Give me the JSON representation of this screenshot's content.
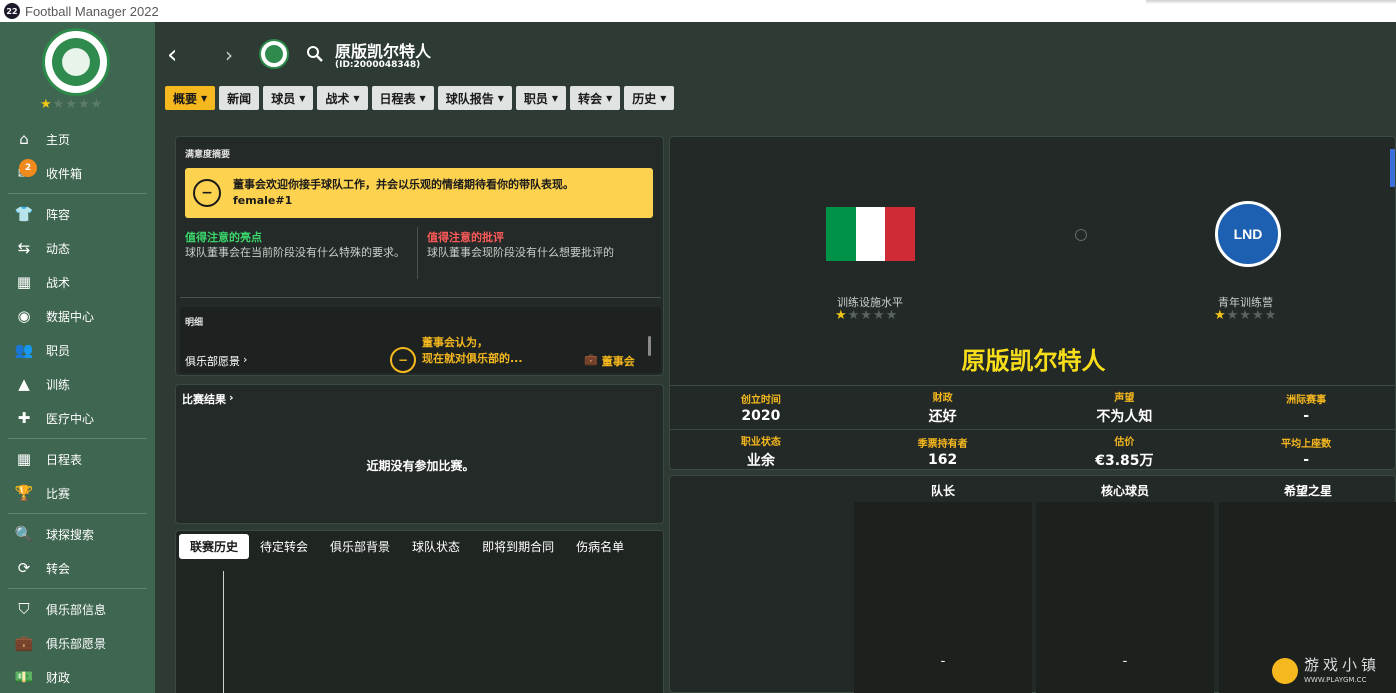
{
  "window": {
    "app_badge": "22",
    "title": "Football Manager 2022"
  },
  "sidebar": {
    "stars": "★★★★★",
    "inbox_badge": "2",
    "items": [
      {
        "icon": "home-icon",
        "glyph": "⌂",
        "label": "主页"
      },
      {
        "icon": "inbox-icon",
        "glyph": "✉",
        "label": "收件箱"
      },
      {
        "icon": "shirt-icon",
        "glyph": "👕",
        "label": "阵容"
      },
      {
        "icon": "dynamics-icon",
        "glyph": "⇆",
        "label": "动态"
      },
      {
        "icon": "tactics-icon",
        "glyph": "▦",
        "label": "战术"
      },
      {
        "icon": "data-hub-icon",
        "glyph": "◉",
        "label": "数据中心"
      },
      {
        "icon": "staff-icon",
        "glyph": "👥",
        "label": "职员"
      },
      {
        "icon": "training-icon",
        "glyph": "▲",
        "label": "训练"
      },
      {
        "icon": "medical-icon",
        "glyph": "✚",
        "label": "医疗中心"
      },
      {
        "icon": "calendar-icon",
        "glyph": "▦",
        "label": "日程表"
      },
      {
        "icon": "trophy-icon",
        "glyph": "🏆",
        "label": "比赛"
      },
      {
        "icon": "scouting-icon",
        "glyph": "🔍",
        "label": "球探搜索"
      },
      {
        "icon": "transfers-icon",
        "glyph": "⟳",
        "label": "转会"
      },
      {
        "icon": "club-info-icon",
        "glyph": "⛉",
        "label": "俱乐部信息"
      },
      {
        "icon": "club-vision-icon",
        "glyph": "💼",
        "label": "俱乐部愿景"
      },
      {
        "icon": "finances-icon",
        "glyph": "💵",
        "label": "财政"
      }
    ]
  },
  "header": {
    "club_name": "原版凯尔特人",
    "club_id": "(ID:2000048348)"
  },
  "tabs": [
    {
      "label": "概要",
      "dropdown": true
    },
    {
      "label": "新闻",
      "dropdown": false
    },
    {
      "label": "球员",
      "dropdown": true
    },
    {
      "label": "战术",
      "dropdown": true
    },
    {
      "label": "日程表",
      "dropdown": true
    },
    {
      "label": "球队报告",
      "dropdown": true
    },
    {
      "label": "职员",
      "dropdown": true
    },
    {
      "label": "转会",
      "dropdown": true
    },
    {
      "label": "历史",
      "dropdown": true
    }
  ],
  "satisfaction": {
    "title": "满意度摘要",
    "message": "董事会欢迎你接手球队工作，并会以乐观的情绪期待看你的带队表现。female#1",
    "highlights_title": "值得注意的亮点",
    "highlights_body": "球队董事会在当前阶段没有什么特殊的要求。",
    "criticism_title": "值得注意的批评",
    "criticism_body": "球队董事会现阶段没有什么想要批评的",
    "details_title": "明细",
    "club_vision_link": "俱乐部愿景",
    "board_opinion": "董事会认为，\n现在就对俱乐部的...",
    "board_label": "董事会"
  },
  "results": {
    "title": "比赛结果",
    "empty_text": "近期没有参加比赛。"
  },
  "bottom_tabs": [
    "联赛历史",
    "待定转会",
    "俱乐部背景",
    "球队状态",
    "即将到期合同",
    "伤病名单"
  ],
  "club": {
    "name": "原版凯尔特人",
    "nation_flag": {
      "colors": [
        "#009246",
        "#ffffff",
        "#ce2b37"
      ]
    },
    "league_logo_text": "LND",
    "training_label": "训练设施水平",
    "training_stars": "★★★★★",
    "youth_label": "青年训练营",
    "youth_stars": "★★★★★",
    "info": [
      [
        {
          "k": "创立时间",
          "v": "2020"
        },
        {
          "k": "财政",
          "v": "还好"
        },
        {
          "k": "声望",
          "v": "不为人知"
        },
        {
          "k": "洲际赛事",
          "v": "-"
        }
      ],
      [
        {
          "k": "职业状态",
          "v": "业余"
        },
        {
          "k": "季票持有者",
          "v": "162"
        },
        {
          "k": "估价",
          "v": "€3.85万"
        },
        {
          "k": "平均上座数",
          "v": "-"
        }
      ]
    ]
  },
  "key_players": [
    {
      "title": "队长",
      "value": "-"
    },
    {
      "title": "核心球员",
      "value": "-"
    },
    {
      "title": "希望之星",
      "value": "-"
    }
  ],
  "watermark": {
    "text": "游戏小镇",
    "url": "WWW.PLAYGM.CC"
  },
  "colors": {
    "accent": "#f5b81e",
    "sidebar": "#3f6650",
    "highlight_green": "#3ad66b",
    "criticism_red": "#ff5a5a",
    "club_name_yellow": "#f7dd1a"
  }
}
